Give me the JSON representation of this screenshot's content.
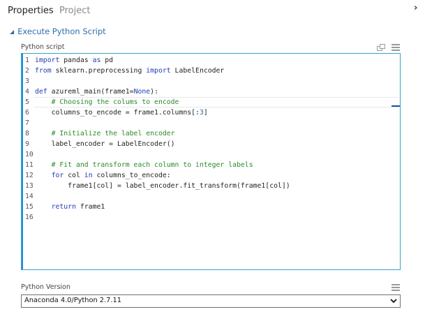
{
  "tabs": [
    {
      "label": "Properties",
      "active": true
    },
    {
      "label": "Project",
      "active": false
    }
  ],
  "section": {
    "title": "Execute Python Script",
    "expanded": true
  },
  "script": {
    "label": "Python script",
    "lines": [
      {
        "n": "1",
        "text": "import pandas as pd"
      },
      {
        "n": "2",
        "text": "from sklearn.preprocessing import LabelEncoder"
      },
      {
        "n": "3",
        "text": ""
      },
      {
        "n": "4",
        "text": "def azureml_main(frame1=None):"
      },
      {
        "n": "5",
        "text": "    # Choosing the colums to encode"
      },
      {
        "n": "6",
        "text": "    columns_to_encode = frame1.columns[:3]"
      },
      {
        "n": "7",
        "text": ""
      },
      {
        "n": "8",
        "text": "    # Initialize the label encoder"
      },
      {
        "n": "9",
        "text": "    label_encoder = LabelEncoder()"
      },
      {
        "n": "10",
        "text": ""
      },
      {
        "n": "11",
        "text": "    # Fit and transform each column to integer labels"
      },
      {
        "n": "12",
        "text": "    for col in columns_to_encode:"
      },
      {
        "n": "13",
        "text": "        frame1[col] = label_encoder.fit_transform(frame1[col])"
      },
      {
        "n": "14",
        "text": ""
      },
      {
        "n": "15",
        "text": "    return frame1"
      },
      {
        "n": "16",
        "text": ""
      }
    ],
    "active_line": 5
  },
  "version": {
    "label": "Python Version",
    "selected": "Anaconda 4.0/Python 2.7.11"
  },
  "icons": {
    "collapse": "chevron-right-icon",
    "section_toggle": "triangle-down-icon",
    "popout": "popout-icon",
    "menu": "hamburger-icon"
  },
  "colors": {
    "accent": "#2e6fb0",
    "editor_border": "#3aa3c4",
    "keyword": "#1f3cb8",
    "comment": "#2b8a2b"
  }
}
